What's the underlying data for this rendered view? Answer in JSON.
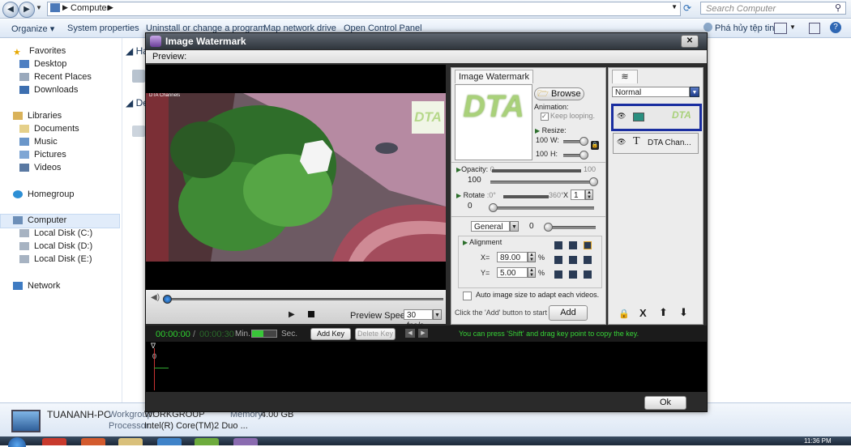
{
  "explorer": {
    "breadcrumb": "Computer",
    "search_placeholder": "Search Computer",
    "commands": [
      "Organize ▾",
      "System properties",
      "Uninstall or change a program",
      "Map network drive",
      "Open Control Panel"
    ],
    "right_command": "Phá hủy tệp tin",
    "nav": {
      "favorites": "Favorites",
      "desktop": "Desktop",
      "recent": "Recent Places",
      "downloads": "Downloads",
      "libraries": "Libraries",
      "documents": "Documents",
      "music": "Music",
      "pictures": "Pictures",
      "videos": "Videos",
      "homegroup": "Homegroup",
      "computer": "Computer",
      "disk_c": "Local Disk (C:)",
      "disk_d": "Local Disk (D:)",
      "disk_e": "Local Disk (E:)",
      "network": "Network"
    },
    "group_hdd": "Ha",
    "group_dev": "De",
    "details": {
      "pc_name": "TUANANH-PC",
      "workgroup_label": "Workgroup:",
      "workgroup": "WORKGROUP",
      "memory_label": "Memory:",
      "memory": "4.00 GB",
      "processor_label": "Processor:",
      "processor": "Intel(R) Core(TM)2 Duo ..."
    },
    "clock": "11:36 PM"
  },
  "dialog": {
    "title": "Image Watermark",
    "preview_label": "Preview:",
    "video_overlay_text": "DTA Channels",
    "watermark_text": "DTA",
    "preview_speed_label": "Preview Speed:",
    "preview_speed_value": "30 fps/s",
    "tab_label": "Image Watermark",
    "browse_label": "Browse",
    "animation_label": "Animation:",
    "keep_looping_label": "Keep looping.",
    "resize_label": "Resize:",
    "w_value": "100",
    "w_label": "W:",
    "h_value": "100",
    "h_label": "H:",
    "opacity_label": "Opacity:",
    "opacity_min": "0",
    "opacity_max": "100",
    "opacity_value": "100",
    "rotate_label": "Rotate",
    "rotate_min": ":0°",
    "rotate_max": "360°",
    "rotate_mult": "X",
    "rotate_count": "1",
    "rotate_value": "0",
    "blend_mode": "General",
    "blend_value": "0",
    "alignment_label": "Alignment",
    "x_label": "X=",
    "x_value": "89.00",
    "y_label": "Y=",
    "y_value": "5.00",
    "pct": "%",
    "auto_size_label": "Auto image size to adapt each videos.",
    "hint_add": "Click the 'Add' button to start ->",
    "add_label": "Add",
    "layer_mode": "Normal",
    "layers": [
      {
        "name": "DTA"
      },
      {
        "name": "DTA Chan..."
      }
    ],
    "time_current": "00:00:00",
    "time_sep": "/",
    "time_total": "00:00:30",
    "min_label": "Min.",
    "sec_label": "Sec.",
    "add_key_label": "Add Key",
    "delete_key_label": "Delete Key",
    "key_hint": "You can press 'Shift' and drag key point to copy the key.",
    "timeline_zero": "0",
    "ok_label": "Ok"
  },
  "colors": {
    "accent_blue": "#1a2ea0",
    "hint_green": "#37d437",
    "time_green": "#2fd02f",
    "dialog_dark": "#2c2c2c"
  }
}
